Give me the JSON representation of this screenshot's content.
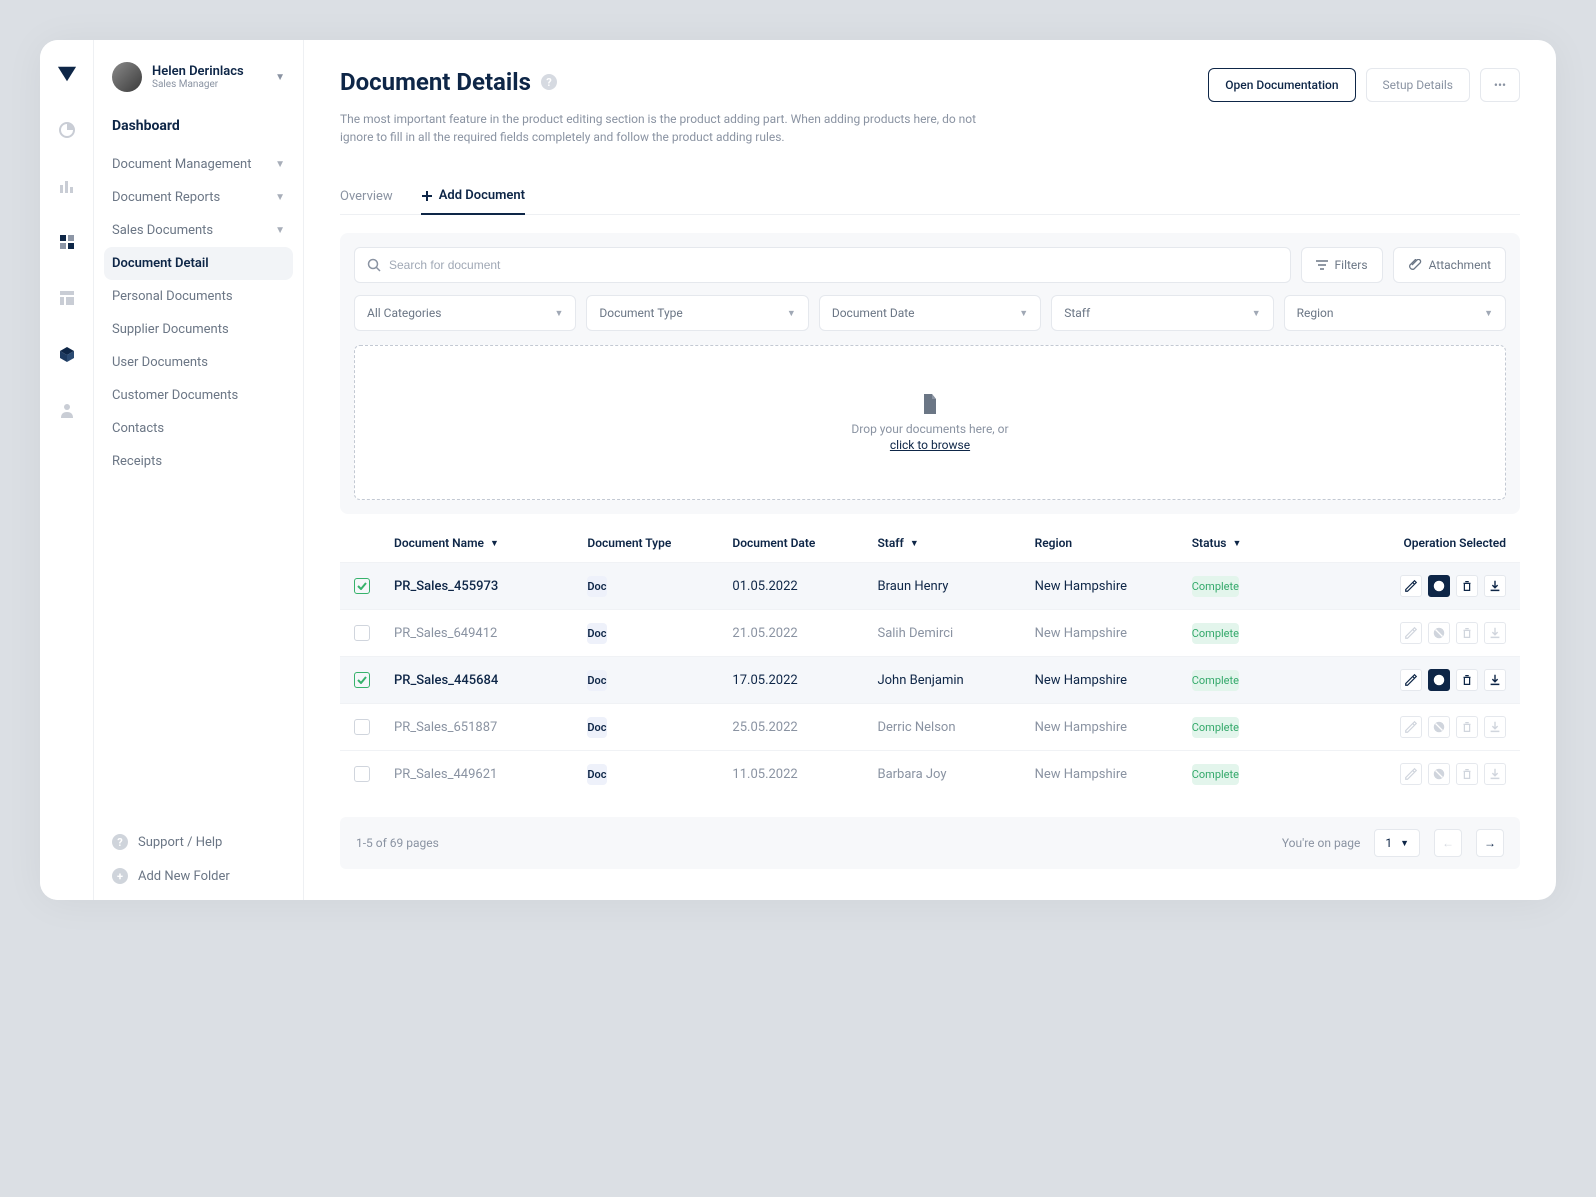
{
  "user": {
    "name": "Helen Derinlacs",
    "role": "Sales Manager"
  },
  "nav": {
    "heading": "Dashboard",
    "items": [
      {
        "label": "Document Management",
        "caret": true
      },
      {
        "label": "Document Reports",
        "caret": true
      },
      {
        "label": "Sales Documents",
        "caret": true
      },
      {
        "label": "Document Detail",
        "active": true
      },
      {
        "label": "Personal Documents"
      },
      {
        "label": "Supplier Documents"
      },
      {
        "label": "User Documents"
      },
      {
        "label": "Customer Documents"
      },
      {
        "label": "Contacts"
      },
      {
        "label": "Receipts"
      }
    ],
    "support": "Support / Help",
    "add_folder": "Add New Folder"
  },
  "header": {
    "title": "Document Details",
    "description": "The most important feature in the product editing section is the product adding part. When adding products here, do not ignore to fill in all the required fields completely and follow the product adding rules.",
    "open_doc": "Open Documentation",
    "setup": "Setup Details"
  },
  "tabs": {
    "overview": "Overview",
    "add": "Add Document"
  },
  "toolbar": {
    "search_placeholder": "Search for document",
    "filters": "Filters",
    "attachment": "Attachment",
    "selects": [
      "All Categories",
      "Document Type",
      "Document Date",
      "Staff",
      "Region"
    ]
  },
  "dropzone": {
    "text": "Drop your documents here, or",
    "link": "click to browse"
  },
  "table": {
    "columns": [
      "Document Name",
      "Document Type",
      "Document Date",
      "Staff",
      "Region",
      "Status",
      "Operation Selected"
    ],
    "rows": [
      {
        "checked": true,
        "name": "PR_Sales_455973",
        "type": "Doc",
        "date": "01.05.2022",
        "staff": "Braun Henry",
        "region": "New Hampshire",
        "status": "Complete"
      },
      {
        "checked": false,
        "name": "PR_Sales_649412",
        "type": "Doc",
        "date": "21.05.2022",
        "staff": "Salih Demirci",
        "region": "New Hampshire",
        "status": "Complete"
      },
      {
        "checked": true,
        "name": "PR_Sales_445684",
        "type": "Doc",
        "date": "17.05.2022",
        "staff": "John Benjamin",
        "region": "New Hampshire",
        "status": "Complete"
      },
      {
        "checked": false,
        "name": "PR_Sales_651887",
        "type": "Doc",
        "date": "25.05.2022",
        "staff": "Derric Nelson",
        "region": "New Hampshire",
        "status": "Complete"
      },
      {
        "checked": false,
        "name": "PR_Sales_449621",
        "type": "Doc",
        "date": "11.05.2022",
        "staff": "Barbara Joy",
        "region": "New Hampshire",
        "status": "Complete"
      }
    ]
  },
  "pagination": {
    "summary": "1-5 of 69 pages",
    "on_page": "You're on page",
    "page": "1"
  }
}
